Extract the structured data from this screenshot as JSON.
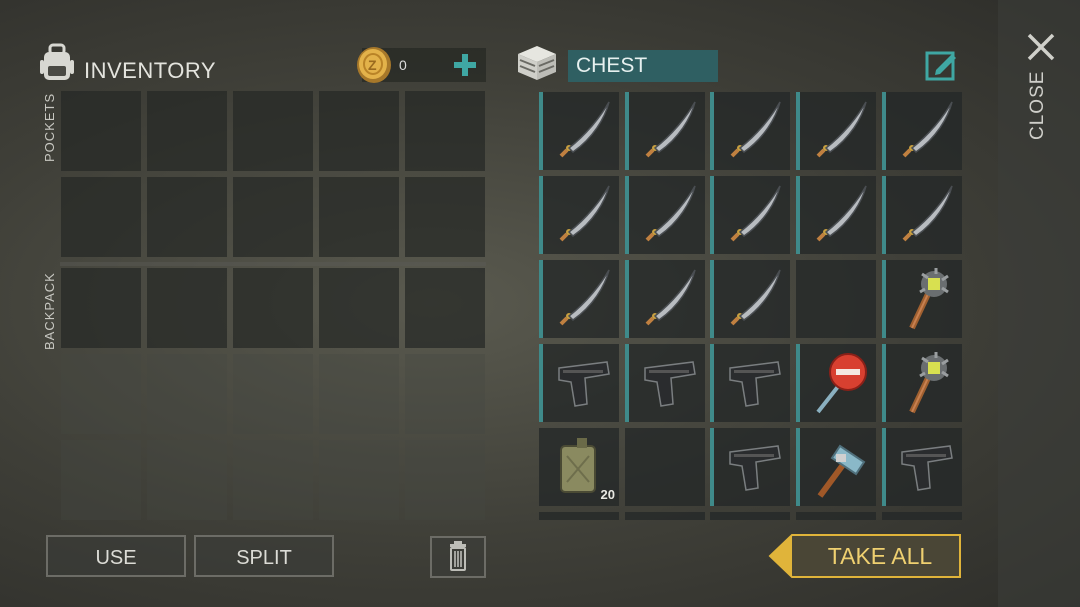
{
  "inventory": {
    "title": "INVENTORY",
    "coins": "0",
    "pockets_label": "POCKETS",
    "backpack_label": "BACKPACK",
    "buttons": {
      "use": "USE",
      "split": "SPLIT"
    }
  },
  "chest": {
    "title": "CHEST",
    "take_all": "TAKE ALL",
    "slots": [
      {
        "item": "machete-icon"
      },
      {
        "item": "machete-icon"
      },
      {
        "item": "machete-icon"
      },
      {
        "item": "machete-icon"
      },
      {
        "item": "machete-icon"
      },
      {
        "item": "machete-icon"
      },
      {
        "item": "machete-icon"
      },
      {
        "item": "machete-icon"
      },
      {
        "item": "machete-icon"
      },
      {
        "item": "machete-icon"
      },
      {
        "item": "machete-icon"
      },
      {
        "item": "machete-icon"
      },
      {
        "item": "machete-icon"
      },
      {
        "item": "empty"
      },
      {
        "item": "spiked-club-icon"
      },
      {
        "item": "pistol-icon"
      },
      {
        "item": "pistol-icon"
      },
      {
        "item": "pistol-icon"
      },
      {
        "item": "stop-sign-icon"
      },
      {
        "item": "spiked-club-icon"
      },
      {
        "item": "fuel-canister-icon",
        "quantity": "20"
      },
      {
        "item": "empty"
      },
      {
        "item": "pistol-icon"
      },
      {
        "item": "hammer-icon"
      },
      {
        "item": "pistol-icon"
      }
    ]
  },
  "close_label": "CLOSE",
  "colors": {
    "accent_teal": "#3f8a8a",
    "chest_label_bg": "#2f5f62",
    "take_all_gold": "#e0b43a"
  }
}
